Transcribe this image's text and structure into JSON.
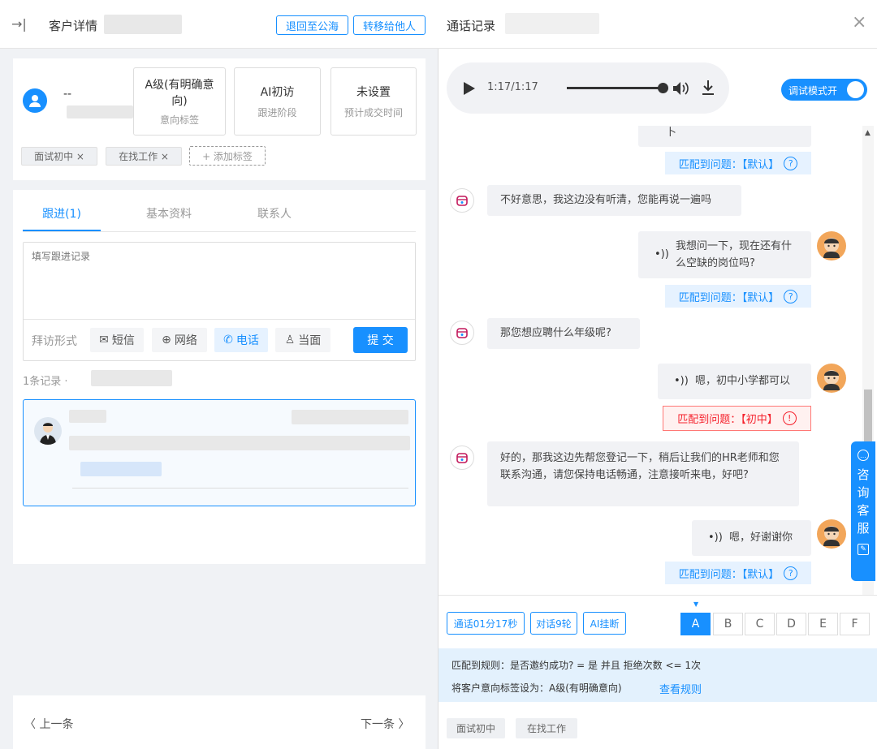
{
  "left": {
    "header": {
      "back_icon": "→|",
      "title": "客户详情",
      "return_btn": "退回至公海",
      "transfer_btn": "转移给他人"
    },
    "customer": {
      "name": "--"
    },
    "stats": [
      {
        "main": "A级(有明确意向)",
        "sub": "意向标签"
      },
      {
        "main": "AI初访",
        "sub": "跟进阶段"
      },
      {
        "main": "未设置",
        "sub": "预计成交时间"
      }
    ],
    "tags": [
      "面试初中 ×",
      "在找工作 ×"
    ],
    "add_tag": "+ 添加标签",
    "tabs": [
      "跟进(1)",
      "基本资料",
      "联系人"
    ],
    "followup_placeholder": "填写跟进记录",
    "visit_label": "拜访形式",
    "modes": [
      {
        "icon": "✉",
        "label": "短信"
      },
      {
        "icon": "⊕",
        "label": "网络"
      },
      {
        "icon": "✆",
        "label": "电话"
      },
      {
        "icon": "♙",
        "label": "当面"
      }
    ],
    "submit": "提 交",
    "records_count": "1条记录 ·",
    "prev": "〈 上一条",
    "next": "下一条 〉"
  },
  "right": {
    "title": "通话记录",
    "close": "×",
    "player": {
      "time": "1:17/1:17",
      "progress": 1.0
    },
    "debug_toggle": "调试模式开",
    "messages": {
      "partial_text": "卜",
      "match_default": "匹配到问题：【默认】",
      "m1": "不好意思，我这边没有听清，您能再说一遍吗",
      "u1": "我想问一下，现在还有什么空缺的岗位吗?",
      "m2": "那您想应聘什么年级呢?",
      "u2": "嗯，初中小学都可以",
      "match_warn": "匹配到问题：【初中】",
      "m3": "好的，那我这边先帮您登记一下，稍后让我们的HR老师和您联系沟通，请您保持电话畅通，注意接听来电，好吧?",
      "u3": "嗯，好谢谢你"
    },
    "summary": {
      "duration": "通话01分17秒",
      "rounds": "对话9轮",
      "hangup": "AI挂断"
    },
    "letters": [
      "A",
      "B",
      "C",
      "D",
      "E",
      "F"
    ],
    "rule_line1": "匹配到规则：是否邀约成功? = 是 并且 拒绝次数 <= 1次",
    "rule_line2": "将客户意向标签设为：A级(有明确意向)",
    "rule_link": "查看规则",
    "bottom_tags": [
      "面试初中",
      "在找工作"
    ],
    "service": [
      "咨",
      "询",
      "客",
      "服"
    ]
  },
  "colors": {
    "accent": "#1890ff",
    "warn": "#f5222d"
  }
}
